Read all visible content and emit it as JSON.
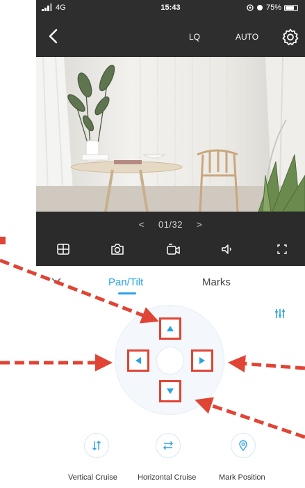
{
  "status_bar": {
    "network": "4G",
    "time": "15:43",
    "battery": "75%",
    "battery_level": 0.75
  },
  "nav": {
    "quality": "LQ",
    "mode": "AUTO"
  },
  "video": {
    "pager": {
      "prev": "<",
      "value": "01/32",
      "next": ">"
    }
  },
  "controls": [
    "grid-view-icon",
    "camera-icon",
    "video-record-icon",
    "speaker-icon",
    "fullscreen-icon"
  ],
  "tabs": [
    {
      "label": "Pan/Tilt",
      "active": true
    },
    {
      "label": "Marks",
      "active": false
    }
  ],
  "actions": [
    {
      "label": "Vertical Cruise",
      "icon": "vertical-cruise-icon"
    },
    {
      "label": "Horizontal Cruise",
      "icon": "horizontal-cruise-icon"
    },
    {
      "label": "Mark Position",
      "icon": "location-pin-icon"
    }
  ],
  "colors": {
    "accent": "#29a3e6",
    "annotation": "#e04434",
    "bar": "#2e2e2e"
  }
}
